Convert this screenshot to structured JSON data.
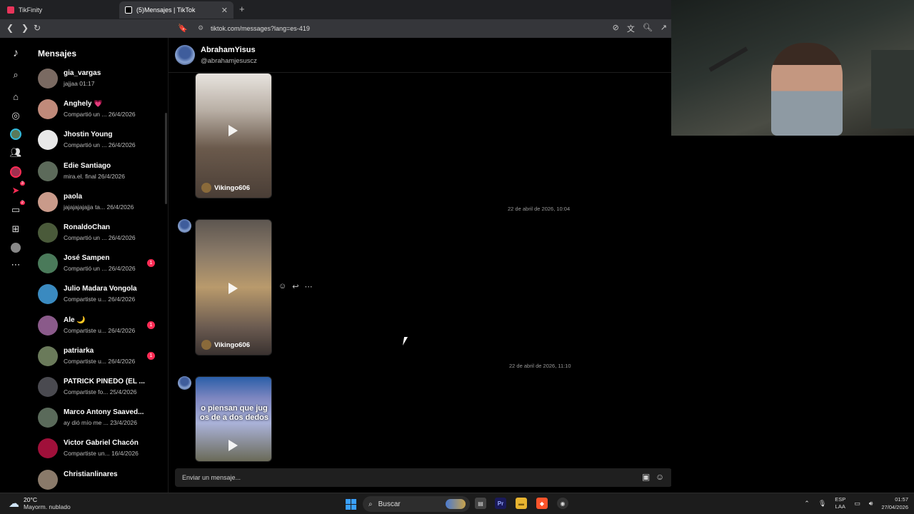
{
  "browser": {
    "tabs": [
      {
        "label": "TikFinity",
        "active": false
      },
      {
        "label": "(5)Mensajes | TikTok",
        "active": true
      }
    ],
    "url": "tiktok.com/messages?lang=es-419"
  },
  "sidebar": {
    "title": "Mensajes",
    "rail_badges": {
      "inbox": "2",
      "send": "3"
    },
    "conversations": [
      {
        "name": "gia_vargas",
        "preview": "jajjaa 01:17",
        "badge": ""
      },
      {
        "name": "Anghely 💗",
        "preview": "Compartió un ...  26/4/2026",
        "badge": ""
      },
      {
        "name": "Jhostin Young",
        "preview": "Compartió un ...  26/4/2026",
        "badge": ""
      },
      {
        "name": "Edie Santiago",
        "preview": "mira.el. final 26/4/2026",
        "badge": ""
      },
      {
        "name": "paola",
        "preview": "jajajajajajja ta...  26/4/2026",
        "badge": ""
      },
      {
        "name": "RonaldoChan",
        "preview": "Compartió un ...  26/4/2026",
        "badge": ""
      },
      {
        "name": "José Sampen",
        "preview": "Compartió un ...  26/4/2026",
        "badge": "1"
      },
      {
        "name": "Julio Madara Vongola",
        "preview": "Compartiste u...  26/4/2026",
        "badge": ""
      },
      {
        "name": "Ale 🌙",
        "preview": "Compartiste u...  26/4/2026",
        "badge": "1"
      },
      {
        "name": "patriarka",
        "preview": "Compartiste u...  26/4/2026",
        "badge": "1"
      },
      {
        "name": "PATRICK PINEDO (EL ...",
        "preview": "Compartiste fo...  25/4/2026",
        "badge": ""
      },
      {
        "name": "Marco Antony Saaved...",
        "preview": "ay dió mío me ...  23/4/2026",
        "badge": ""
      },
      {
        "name": "Victor Gabriel Chacón",
        "preview": "Compartiste un...  16/4/2026",
        "badge": ""
      },
      {
        "name": "Christianlinares",
        "preview": "",
        "badge": ""
      }
    ]
  },
  "chat": {
    "contact_name": "AbrahamYisus",
    "contact_handle": "@abrahamjesuscz",
    "messages": [
      {
        "author": "Vikingo606"
      },
      {
        "timestamp": "22 de abril de 2026, 10:04",
        "author": "Vikingo606"
      },
      {
        "timestamp": "22 de abril de 2026, 11:10",
        "overlay": "o piensan que jug\nos de a dos dedos"
      }
    ],
    "composer_placeholder": "Enviar un mensaje..."
  },
  "taskbar": {
    "weather_temp": "20°C",
    "weather_desc": "Mayorm. nublado",
    "search_label": "Buscar",
    "lang_line1": "ESP",
    "lang_line2": "LAA",
    "time": "01:57",
    "date": "27/04/2026"
  }
}
